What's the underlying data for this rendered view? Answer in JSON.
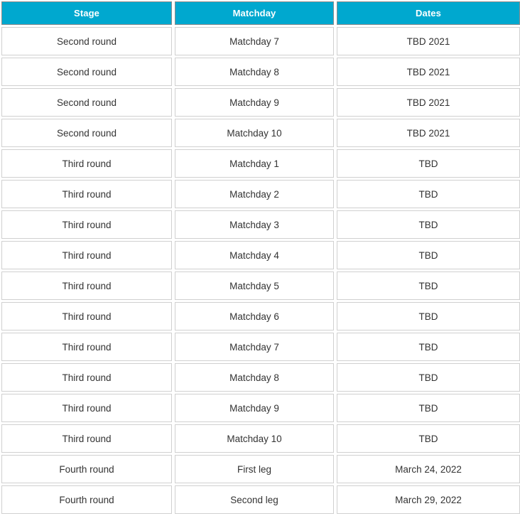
{
  "table": {
    "name": "competition-schedule",
    "columns": [
      {
        "key": "stage",
        "label": "Stage"
      },
      {
        "key": "matchday",
        "label": "Matchday"
      },
      {
        "key": "dates",
        "label": "Dates"
      }
    ],
    "header_background": "#00a8cf",
    "header_text_color": "#ffffff",
    "body_text_color": "#333333",
    "cell_border_color": "#d0d0d0",
    "rows": [
      {
        "stage": "Second round",
        "matchday": "Matchday 7",
        "dates": "TBD 2021"
      },
      {
        "stage": "Second round",
        "matchday": "Matchday 8",
        "dates": "TBD 2021"
      },
      {
        "stage": "Second round",
        "matchday": "Matchday 9",
        "dates": "TBD 2021"
      },
      {
        "stage": "Second round",
        "matchday": "Matchday 10",
        "dates": "TBD 2021"
      },
      {
        "stage": "Third round",
        "matchday": "Matchday 1",
        "dates": "TBD"
      },
      {
        "stage": "Third round",
        "matchday": "Matchday 2",
        "dates": "TBD"
      },
      {
        "stage": "Third round",
        "matchday": "Matchday 3",
        "dates": "TBD"
      },
      {
        "stage": "Third round",
        "matchday": "Matchday 4",
        "dates": "TBD"
      },
      {
        "stage": "Third round",
        "matchday": "Matchday 5",
        "dates": "TBD"
      },
      {
        "stage": "Third round",
        "matchday": "Matchday 6",
        "dates": "TBD"
      },
      {
        "stage": "Third round",
        "matchday": "Matchday 7",
        "dates": "TBD"
      },
      {
        "stage": "Third round",
        "matchday": "Matchday 8",
        "dates": "TBD"
      },
      {
        "stage": "Third round",
        "matchday": "Matchday 9",
        "dates": "TBD"
      },
      {
        "stage": "Third round",
        "matchday": "Matchday 10",
        "dates": "TBD"
      },
      {
        "stage": "Fourth round",
        "matchday": "First leg",
        "dates": "March 24, 2022"
      },
      {
        "stage": "Fourth round",
        "matchday": "Second leg",
        "dates": "March 29, 2022"
      }
    ]
  }
}
